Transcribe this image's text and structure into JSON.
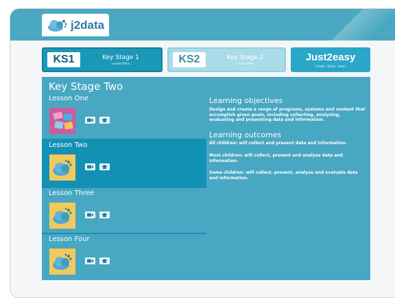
{
  "logo": {
    "name": "j2data"
  },
  "stage_tabs": [
    {
      "badge": "KS1",
      "title": "Key Stage 1",
      "subtitle": "Lesson Plans"
    },
    {
      "badge": "KS2",
      "title": "Key Stage 2",
      "subtitle": "Lesson Plans"
    }
  ],
  "just2easy": {
    "name": "Just2easy",
    "tagline": "Create · Share · Learn"
  },
  "main": {
    "title": "Key Stage Two",
    "lessons": [
      {
        "title": "Lesson One",
        "icon": "tiles-thumbnail-icon"
      },
      {
        "title": "Lesson Two",
        "icon": "data-cloud-icon"
      },
      {
        "title": "Lesson Three",
        "icon": "data-cloud-icon"
      },
      {
        "title": "Lesson Four",
        "icon": "data-cloud-icon"
      }
    ],
    "objectives": {
      "heading": "Learning objectives",
      "text": "Design and create a range of programs, systems and content that accomplish given goals, including collecting, analysing, evaluating and presenting data and information."
    },
    "outcomes": {
      "heading": "Learning outcomes",
      "all": "All children: will collect and present data and information.",
      "most": "Most children: will collect, present and analyse data and information.",
      "some": "Some children: will collect, present, analyse and evaluate data and information."
    }
  },
  "colors": {
    "header": "#4aa8c2",
    "panel": "#48a7c2",
    "active_row": "#1291b5",
    "badge_text": "#0d5e80"
  }
}
